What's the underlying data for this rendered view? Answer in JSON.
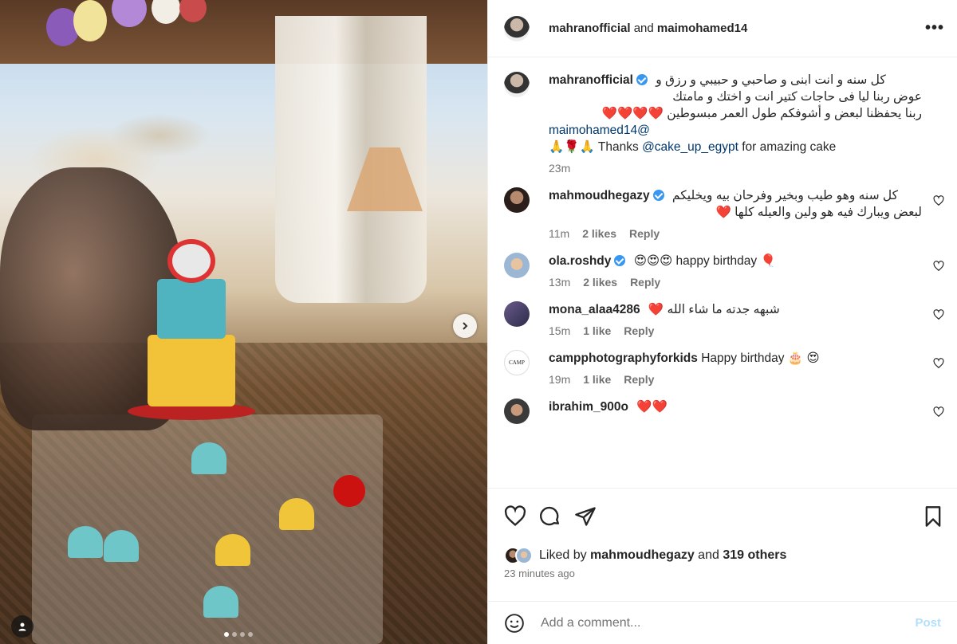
{
  "header": {
    "user1": "mahranofficial",
    "joiner": "and",
    "user2": "maimohamed14",
    "more_label": "•••"
  },
  "caption": {
    "user": "mahranofficial",
    "line1": "كل سنه و انت ابنى و صاحبي و حبيبي و رزق و",
    "line2": "عوض ربنا ليا فى حاجات كتير انت و اختك و مامتك",
    "line3": "ربنا يحفظنا لبعض و أشوفكم طول العمر مبسوطين ❤️❤️❤️❤️",
    "mention": "maimohamed14@",
    "thanks_pre": "🙏🌹🙏 Thanks ",
    "thanks_link": "@cake_up_egypt",
    "thanks_post": " for amazing cake",
    "time": "23m"
  },
  "comments": [
    {
      "user": "mahmoudhegazy",
      "verified": true,
      "text_line1": "كل سنه وهو طيب وبخير وفرحان بيه ويخليكم",
      "text_line2": "لبعض ويبارك فيه هو ولين والعيله كلها ❤️",
      "time": "11m",
      "likes": "2 likes",
      "reply": "Reply"
    },
    {
      "user": "ola.roshdy",
      "verified": true,
      "text": "😍😍😍 happy birthday 🎈",
      "time": "13m",
      "likes": "2 likes",
      "reply": "Reply"
    },
    {
      "user": "mona_alaa4286",
      "verified": false,
      "text": "❤️ شبهه جدته ما شاء الله",
      "time": "15m",
      "likes": "1 like",
      "reply": "Reply"
    },
    {
      "user": "campphotographyforkids",
      "verified": false,
      "text": "Happy birthday 🎂 😍",
      "time": "19m",
      "likes": "1 like",
      "reply": "Reply"
    },
    {
      "user": "ibrahim_900o",
      "verified": false,
      "text": "❤️❤️",
      "time": "",
      "likes": "",
      "reply": ""
    }
  ],
  "likes": {
    "prefix": "Liked by ",
    "user": "mahmoudhegazy",
    "and": " and ",
    "others": "319 others",
    "time": "23 minutes ago"
  },
  "add_comment": {
    "placeholder": "Add a comment...",
    "post_label": "Post"
  },
  "colors": {
    "verified": "#3897f0",
    "link": "#00376b",
    "post": "#b2dffc",
    "heart": "#ed4956"
  }
}
